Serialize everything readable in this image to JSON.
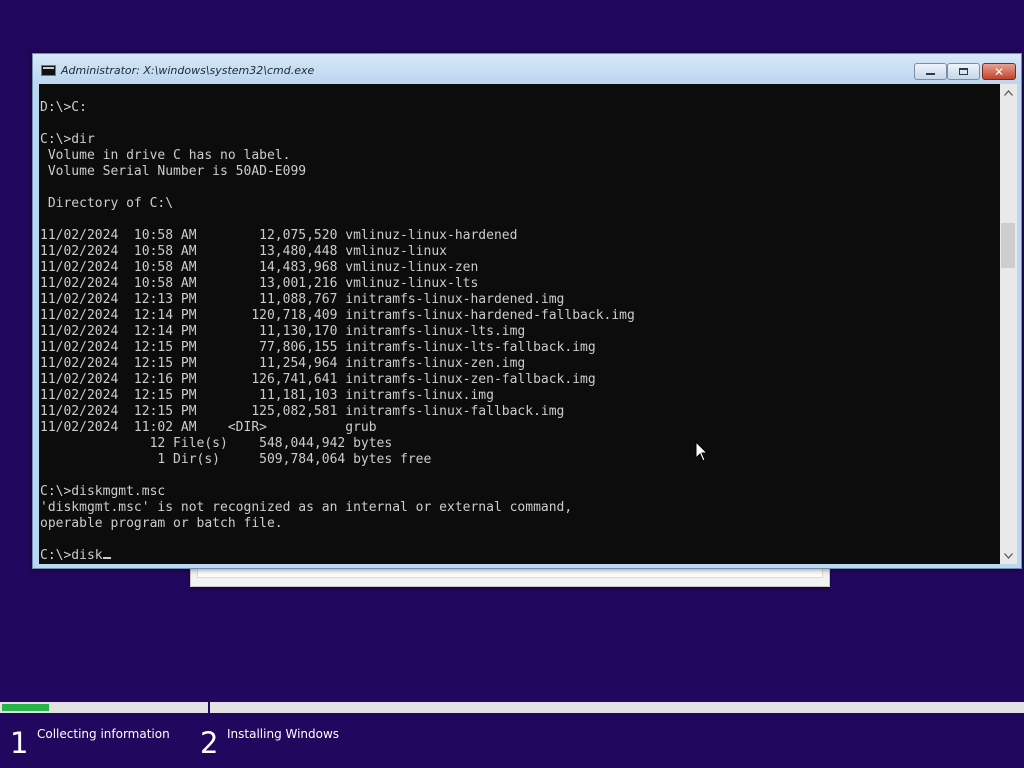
{
  "window": {
    "title": "Administrator: X:\\windows\\system32\\cmd.exe",
    "icon": "cmd-console-icon",
    "buttons": {
      "minimize": "minimize-icon",
      "maximize": "maximize-icon",
      "close": "close-icon",
      "close_glyph": "✕"
    }
  },
  "console": {
    "lines": [
      "D:\\>C:",
      "",
      "C:\\>dir",
      " Volume in drive C has no label.",
      " Volume Serial Number is 50AD-E099",
      "",
      " Directory of C:\\",
      "",
      "11/02/2024  10:58 AM        12,075,520 vmlinuz-linux-hardened",
      "11/02/2024  10:58 AM        13,480,448 vmlinuz-linux",
      "11/02/2024  10:58 AM        14,483,968 vmlinuz-linux-zen",
      "11/02/2024  10:58 AM        13,001,216 vmlinuz-linux-lts",
      "11/02/2024  12:13 PM        11,088,767 initramfs-linux-hardened.img",
      "11/02/2024  12:14 PM       120,718,409 initramfs-linux-hardened-fallback.img",
      "11/02/2024  12:14 PM        11,130,170 initramfs-linux-lts.img",
      "11/02/2024  12:15 PM        77,806,155 initramfs-linux-lts-fallback.img",
      "11/02/2024  12:15 PM        11,254,964 initramfs-linux-zen.img",
      "11/02/2024  12:16 PM       126,741,641 initramfs-linux-zen-fallback.img",
      "11/02/2024  12:15 PM        11,181,103 initramfs-linux.img",
      "11/02/2024  12:15 PM       125,082,581 initramfs-linux-fallback.img",
      "11/02/2024  11:02 AM    <DIR>          grub",
      "              12 File(s)    548,044,942 bytes",
      "               1 Dir(s)     509,784,064 bytes free",
      "",
      "C:\\>diskmgmt.msc",
      "'diskmgmt.msc' is not recognized as an internal or external command,",
      "operable program or batch file.",
      "",
      "C:\\>disk"
    ],
    "colors": {
      "background": "#0c0c0c",
      "foreground": "#cccccc"
    }
  },
  "scrollbar": {
    "up_icon": "scroll-up-arrow-icon",
    "down_icon": "scroll-down-arrow-icon"
  },
  "setup": {
    "progress_fraction": 0.23,
    "accent": "#27b34a",
    "background": "#22075e",
    "steps": [
      {
        "number": "1",
        "label": "Collecting information"
      },
      {
        "number": "2",
        "label": "Installing Windows"
      }
    ]
  }
}
